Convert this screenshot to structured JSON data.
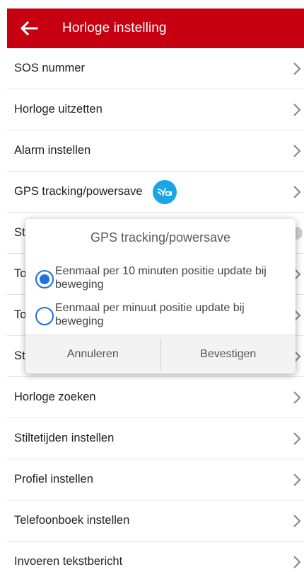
{
  "appbar": {
    "title": "Horloge instelling",
    "back_icon": "arrow-left-icon",
    "color": "#c60010"
  },
  "list": {
    "items": [
      {
        "label": "SOS nummer"
      },
      {
        "label": "Horloge uitzetten"
      },
      {
        "label": "Alarm instellen"
      },
      {
        "label": "GPS tracking/powersave",
        "badge_icon": "gps-powersave-icon"
      },
      {
        "label": "St"
      },
      {
        "label": "To"
      },
      {
        "label": "To"
      },
      {
        "label": "St"
      },
      {
        "label": "Horloge zoeken"
      },
      {
        "label": "Stiltetijden instellen"
      },
      {
        "label": "Profiel instellen"
      },
      {
        "label": "Telefoonboek instellen"
      },
      {
        "label": "Invoeren tekstbericht"
      }
    ],
    "chevron_icon": "chevron-right-icon"
  },
  "dialog": {
    "title": "GPS tracking/powersave",
    "options": [
      {
        "label": "Eenmaal per 10 minuten positie update bij beweging",
        "selected": true
      },
      {
        "label": "Eenmaal per minuut positie update bij beweging",
        "selected": false
      }
    ],
    "cancel_label": "Annuleren",
    "confirm_label": "Bevestigen",
    "accent": "#1f6fe0"
  }
}
